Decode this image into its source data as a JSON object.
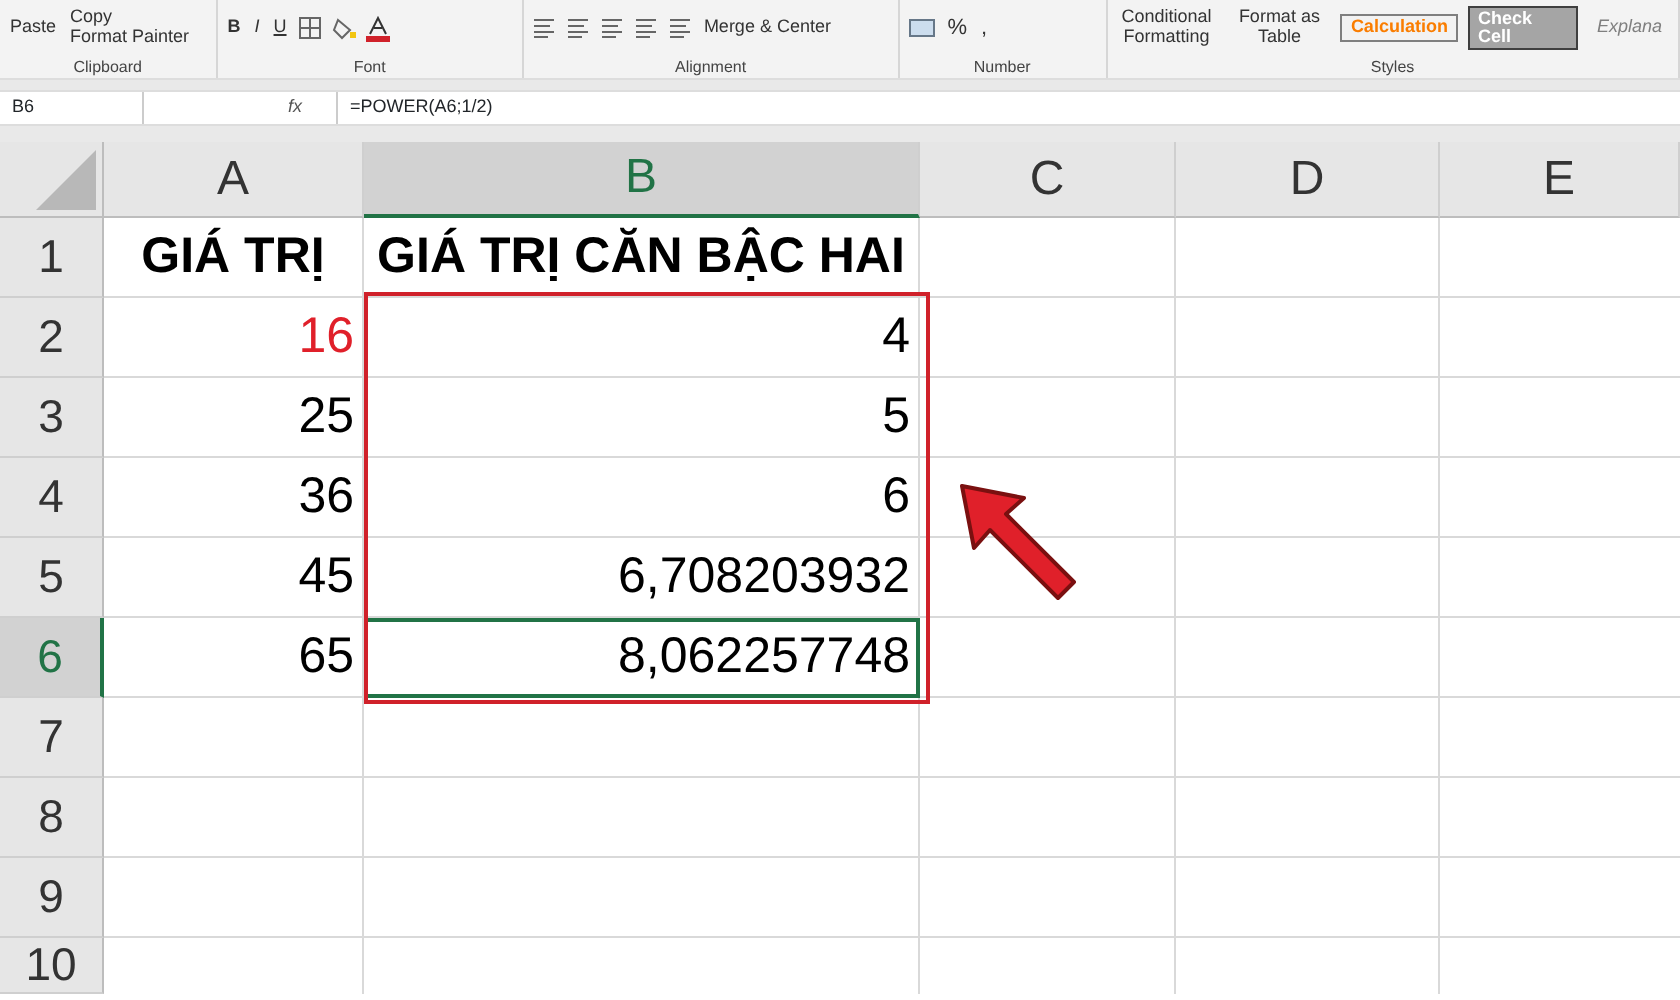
{
  "ribbon": {
    "groups": [
      {
        "kind": "clipboard",
        "label": "Clipboard",
        "items": [
          "Paste",
          "Copy",
          "Format Painter"
        ]
      },
      {
        "kind": "font",
        "label": "Font",
        "items": [
          "B",
          "I",
          "U"
        ]
      },
      {
        "kind": "alignment",
        "label": "Alignment",
        "items": [
          "Merge & Center"
        ]
      },
      {
        "kind": "number",
        "label": "Number",
        "items": [
          "%",
          ","
        ]
      },
      {
        "kind": "styles",
        "label": "Styles",
        "items": [
          "Conditional Formatting",
          "Format as Table"
        ],
        "cell_styles": [
          "Calculation",
          "Check Cell",
          "Explana"
        ]
      }
    ]
  },
  "formula_bar": {
    "name_box": "B6",
    "fx": "fx",
    "formula": "=POWER(A6;1/2)"
  },
  "sheet": {
    "columns": [
      {
        "label": "A",
        "selected": false
      },
      {
        "label": "B",
        "selected": true
      },
      {
        "label": "C",
        "selected": false
      },
      {
        "label": "D",
        "selected": false
      },
      {
        "label": "E",
        "selected": false
      }
    ],
    "rows": [
      {
        "number": "1",
        "selected": false,
        "kind": "header",
        "cells": [
          {
            "text": "GIÁ TRỊ",
            "color": "#000000",
            "outlined": false,
            "active": false
          },
          {
            "text": "GIÁ TRỊ CĂN BẬC HAI",
            "color": "#000000",
            "outlined": false,
            "active": false
          }
        ]
      },
      {
        "number": "2",
        "selected": false,
        "kind": "data",
        "cells": [
          {
            "text": "16",
            "color": "#e0202a",
            "outlined": false,
            "active": false
          },
          {
            "text": "4",
            "color": "#000000",
            "outlined": true,
            "active": false
          }
        ]
      },
      {
        "number": "3",
        "selected": false,
        "kind": "data",
        "cells": [
          {
            "text": "25",
            "color": "#000000",
            "outlined": false,
            "active": false
          },
          {
            "text": "5",
            "color": "#000000",
            "outlined": true,
            "active": false
          }
        ]
      },
      {
        "number": "4",
        "selected": false,
        "kind": "data",
        "cells": [
          {
            "text": "36",
            "color": "#000000",
            "outlined": false,
            "active": false
          },
          {
            "text": "6",
            "color": "#000000",
            "outlined": true,
            "active": false
          }
        ]
      },
      {
        "number": "5",
        "selected": false,
        "kind": "data",
        "cells": [
          {
            "text": "45",
            "color": "#000000",
            "outlined": false,
            "active": false
          },
          {
            "text": "6,708203932",
            "color": "#000000",
            "outlined": true,
            "active": false
          }
        ]
      },
      {
        "number": "6",
        "selected": true,
        "kind": "data",
        "cells": [
          {
            "text": "65",
            "color": "#000000",
            "outlined": false,
            "active": false
          },
          {
            "text": "8,062257748",
            "color": "#000000",
            "outlined": true,
            "active": true
          }
        ]
      },
      {
        "number": "7",
        "selected": false
      },
      {
        "number": "8",
        "selected": false
      },
      {
        "number": "9",
        "selected": false
      },
      {
        "number": "10",
        "selected": false
      }
    ]
  }
}
